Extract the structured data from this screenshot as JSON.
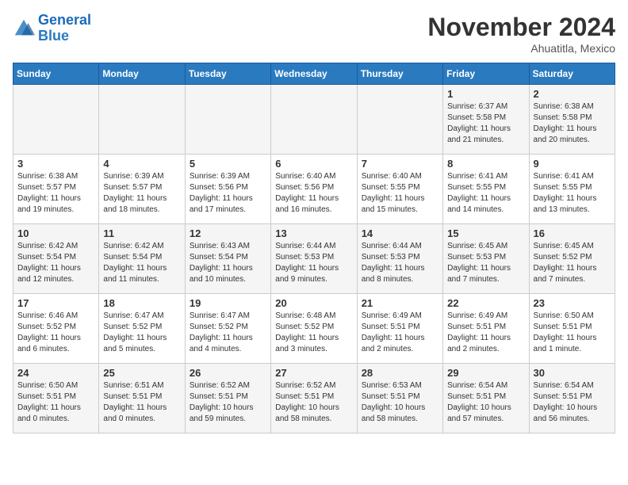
{
  "logo": {
    "line1": "General",
    "line2": "Blue"
  },
  "title": "November 2024",
  "location": "Ahuatitla, Mexico",
  "days_of_week": [
    "Sunday",
    "Monday",
    "Tuesday",
    "Wednesday",
    "Thursday",
    "Friday",
    "Saturday"
  ],
  "weeks": [
    [
      {
        "num": "",
        "info": ""
      },
      {
        "num": "",
        "info": ""
      },
      {
        "num": "",
        "info": ""
      },
      {
        "num": "",
        "info": ""
      },
      {
        "num": "",
        "info": ""
      },
      {
        "num": "1",
        "info": "Sunrise: 6:37 AM\nSunset: 5:58 PM\nDaylight: 11 hours\nand 21 minutes."
      },
      {
        "num": "2",
        "info": "Sunrise: 6:38 AM\nSunset: 5:58 PM\nDaylight: 11 hours\nand 20 minutes."
      }
    ],
    [
      {
        "num": "3",
        "info": "Sunrise: 6:38 AM\nSunset: 5:57 PM\nDaylight: 11 hours\nand 19 minutes."
      },
      {
        "num": "4",
        "info": "Sunrise: 6:39 AM\nSunset: 5:57 PM\nDaylight: 11 hours\nand 18 minutes."
      },
      {
        "num": "5",
        "info": "Sunrise: 6:39 AM\nSunset: 5:56 PM\nDaylight: 11 hours\nand 17 minutes."
      },
      {
        "num": "6",
        "info": "Sunrise: 6:40 AM\nSunset: 5:56 PM\nDaylight: 11 hours\nand 16 minutes."
      },
      {
        "num": "7",
        "info": "Sunrise: 6:40 AM\nSunset: 5:55 PM\nDaylight: 11 hours\nand 15 minutes."
      },
      {
        "num": "8",
        "info": "Sunrise: 6:41 AM\nSunset: 5:55 PM\nDaylight: 11 hours\nand 14 minutes."
      },
      {
        "num": "9",
        "info": "Sunrise: 6:41 AM\nSunset: 5:55 PM\nDaylight: 11 hours\nand 13 minutes."
      }
    ],
    [
      {
        "num": "10",
        "info": "Sunrise: 6:42 AM\nSunset: 5:54 PM\nDaylight: 11 hours\nand 12 minutes."
      },
      {
        "num": "11",
        "info": "Sunrise: 6:42 AM\nSunset: 5:54 PM\nDaylight: 11 hours\nand 11 minutes."
      },
      {
        "num": "12",
        "info": "Sunrise: 6:43 AM\nSunset: 5:54 PM\nDaylight: 11 hours\nand 10 minutes."
      },
      {
        "num": "13",
        "info": "Sunrise: 6:44 AM\nSunset: 5:53 PM\nDaylight: 11 hours\nand 9 minutes."
      },
      {
        "num": "14",
        "info": "Sunrise: 6:44 AM\nSunset: 5:53 PM\nDaylight: 11 hours\nand 8 minutes."
      },
      {
        "num": "15",
        "info": "Sunrise: 6:45 AM\nSunset: 5:53 PM\nDaylight: 11 hours\nand 7 minutes."
      },
      {
        "num": "16",
        "info": "Sunrise: 6:45 AM\nSunset: 5:52 PM\nDaylight: 11 hours\nand 7 minutes."
      }
    ],
    [
      {
        "num": "17",
        "info": "Sunrise: 6:46 AM\nSunset: 5:52 PM\nDaylight: 11 hours\nand 6 minutes."
      },
      {
        "num": "18",
        "info": "Sunrise: 6:47 AM\nSunset: 5:52 PM\nDaylight: 11 hours\nand 5 minutes."
      },
      {
        "num": "19",
        "info": "Sunrise: 6:47 AM\nSunset: 5:52 PM\nDaylight: 11 hours\nand 4 minutes."
      },
      {
        "num": "20",
        "info": "Sunrise: 6:48 AM\nSunset: 5:52 PM\nDaylight: 11 hours\nand 3 minutes."
      },
      {
        "num": "21",
        "info": "Sunrise: 6:49 AM\nSunset: 5:51 PM\nDaylight: 11 hours\nand 2 minutes."
      },
      {
        "num": "22",
        "info": "Sunrise: 6:49 AM\nSunset: 5:51 PM\nDaylight: 11 hours\nand 2 minutes."
      },
      {
        "num": "23",
        "info": "Sunrise: 6:50 AM\nSunset: 5:51 PM\nDaylight: 11 hours\nand 1 minute."
      }
    ],
    [
      {
        "num": "24",
        "info": "Sunrise: 6:50 AM\nSunset: 5:51 PM\nDaylight: 11 hours\nand 0 minutes."
      },
      {
        "num": "25",
        "info": "Sunrise: 6:51 AM\nSunset: 5:51 PM\nDaylight: 11 hours\nand 0 minutes."
      },
      {
        "num": "26",
        "info": "Sunrise: 6:52 AM\nSunset: 5:51 PM\nDaylight: 10 hours\nand 59 minutes."
      },
      {
        "num": "27",
        "info": "Sunrise: 6:52 AM\nSunset: 5:51 PM\nDaylight: 10 hours\nand 58 minutes."
      },
      {
        "num": "28",
        "info": "Sunrise: 6:53 AM\nSunset: 5:51 PM\nDaylight: 10 hours\nand 58 minutes."
      },
      {
        "num": "29",
        "info": "Sunrise: 6:54 AM\nSunset: 5:51 PM\nDaylight: 10 hours\nand 57 minutes."
      },
      {
        "num": "30",
        "info": "Sunrise: 6:54 AM\nSunset: 5:51 PM\nDaylight: 10 hours\nand 56 minutes."
      }
    ]
  ]
}
